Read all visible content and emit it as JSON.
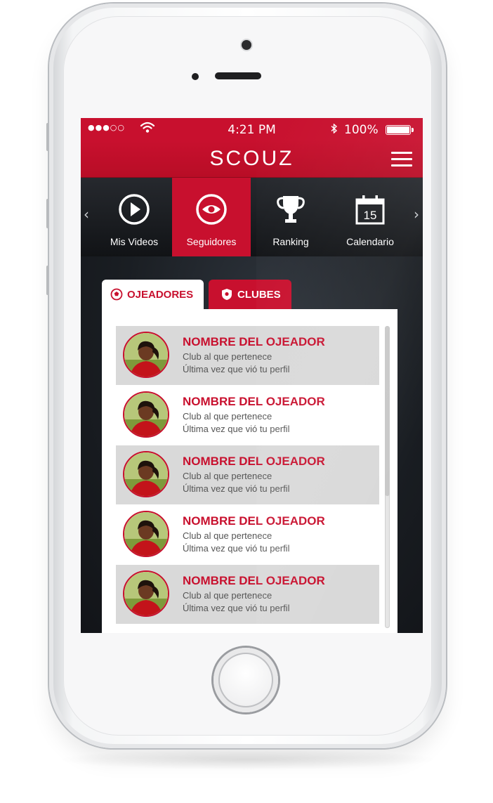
{
  "status_bar": {
    "signal": "●●●○○",
    "wifi_icon": "wifi-icon",
    "time": "4:21 PM",
    "bluetooth_icon": "bluetooth-icon",
    "battery_pct": "100%"
  },
  "header": {
    "logo": "SCOUZ",
    "menu_icon": "hamburger-menu-icon"
  },
  "nav": {
    "prev_arrow": "‹",
    "next_arrow": "›",
    "items": [
      {
        "label": "Mis Videos",
        "icon": "play-icon",
        "active": false
      },
      {
        "label": "Seguidores",
        "icon": "eye-icon",
        "active": true
      },
      {
        "label": "Ranking",
        "icon": "trophy-icon",
        "active": false
      },
      {
        "label": "Calendario",
        "icon": "calendar-icon",
        "active": false,
        "badge": "15"
      }
    ]
  },
  "tabs": [
    {
      "label": "OJEADORES",
      "icon": "soccer-ball-icon",
      "active": true
    },
    {
      "label": "CLUBES",
      "icon": "shield-icon",
      "active": false
    }
  ],
  "scouts": [
    {
      "name": "NOMBRE DEL OJEADOR",
      "club": "Club al que pertenece",
      "last_seen": "Última vez que vió tu perfil"
    },
    {
      "name": "NOMBRE DEL OJEADOR",
      "club": "Club al que pertenece",
      "last_seen": "Última vez que vió tu perfil"
    },
    {
      "name": "NOMBRE DEL OJEADOR",
      "club": "Club al que pertenece",
      "last_seen": "Última vez que vió tu perfil"
    },
    {
      "name": "NOMBRE DEL OJEADOR",
      "club": "Club al que pertenece",
      "last_seen": "Última vez que vió tu perfil"
    },
    {
      "name": "NOMBRE DEL OJEADOR",
      "club": "Club al que pertenece",
      "last_seen": "Última vez que vió tu perfil"
    }
  ],
  "colors": {
    "brand_red": "#c8102e",
    "row_shade": "#d9d9d9",
    "nav_dark": "#111316"
  }
}
